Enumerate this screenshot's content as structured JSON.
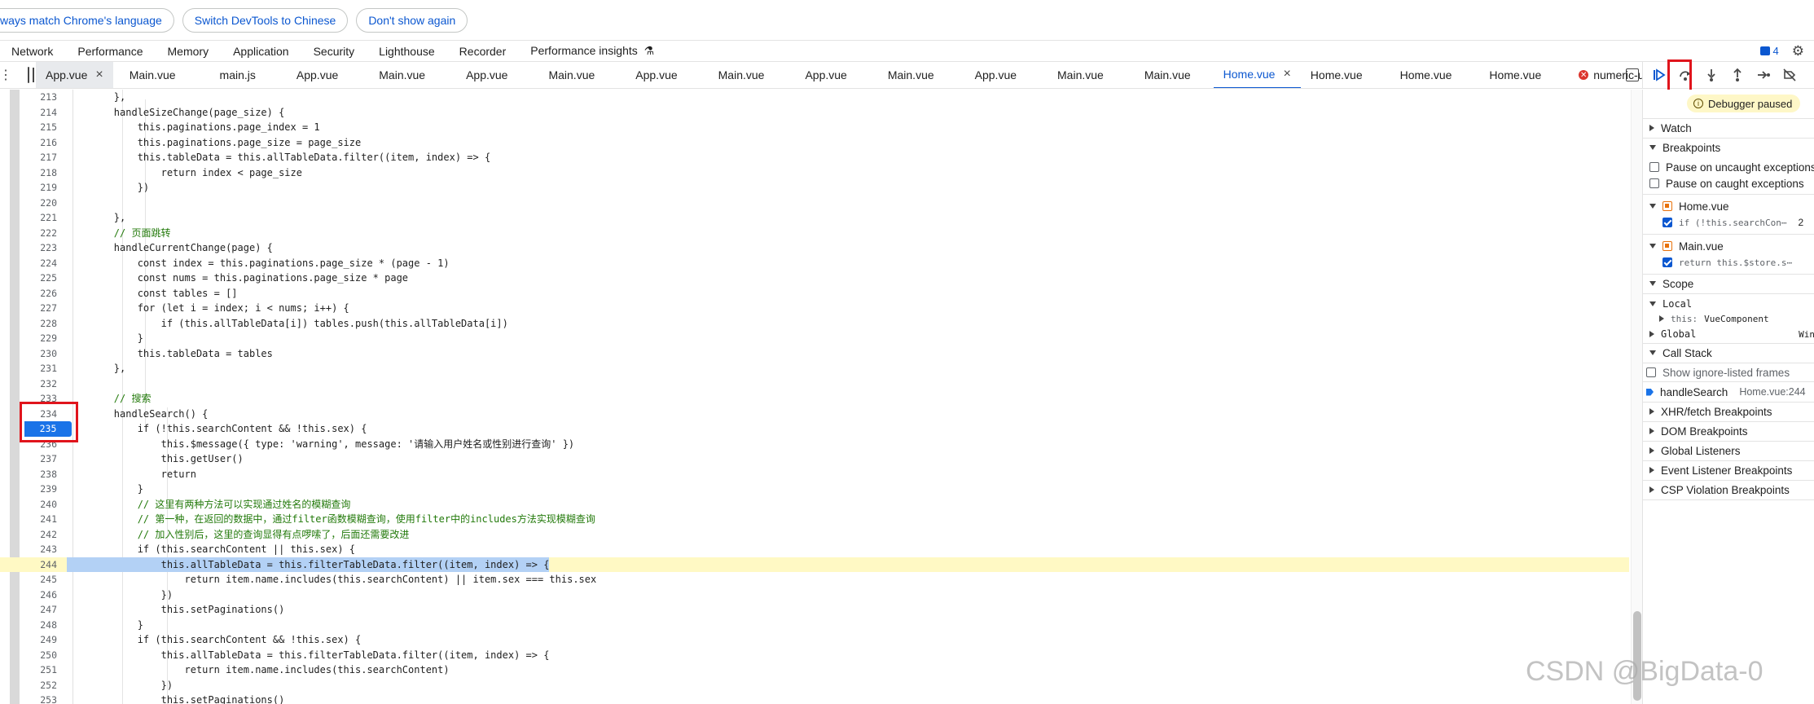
{
  "infobar": {
    "match_language": "ways match Chrome's language",
    "switch_devtools": "Switch DevTools to Chinese",
    "dont_show": "Don't show again"
  },
  "panel_tabs": [
    "Network",
    "Performance",
    "Memory",
    "Application",
    "Security",
    "Lighthouse",
    "Recorder",
    "Performance insights"
  ],
  "message_count": "4",
  "file_tabs": [
    {
      "label": "App.vue",
      "state": "selected"
    },
    {
      "label": "Main.vue"
    },
    {
      "label": "main.js"
    },
    {
      "label": "App.vue"
    },
    {
      "label": "Main.vue"
    },
    {
      "label": "App.vue"
    },
    {
      "label": "Main.vue"
    },
    {
      "label": "App.vue"
    },
    {
      "label": "Main.vue"
    },
    {
      "label": "App.vue"
    },
    {
      "label": "Main.vue"
    },
    {
      "label": "App.vue"
    },
    {
      "label": "Main.vue"
    },
    {
      "label": "Main.vue"
    },
    {
      "label": "Home.vue",
      "state": "active"
    },
    {
      "label": "Home.vue"
    },
    {
      "label": "Home.vue"
    },
    {
      "label": "Home.vue"
    },
    {
      "label": "numeric-unicode-map.ts",
      "state": "error"
    }
  ],
  "code": {
    "paused_line": "244",
    "breakpoint_line": "235",
    "lines": [
      {
        "n": "213",
        "t": "        },"
      },
      {
        "n": "214",
        "t": "        handleSizeChange(page_size) {"
      },
      {
        "n": "215",
        "t": "            this.paginations.page_index = 1"
      },
      {
        "n": "216",
        "t": "            this.paginations.page_size = page_size"
      },
      {
        "n": "217",
        "t": "            this.tableData = this.allTableData.filter((item, index) => {"
      },
      {
        "n": "218",
        "t": "                return index < page_size"
      },
      {
        "n": "219",
        "t": "            })"
      },
      {
        "n": "220",
        "t": ""
      },
      {
        "n": "221",
        "t": "        },"
      },
      {
        "n": "222",
        "t": "        // 页面跳转"
      },
      {
        "n": "223",
        "t": "        handleCurrentChange(page) {"
      },
      {
        "n": "224",
        "t": "            const index = this.paginations.page_size * (page - 1)"
      },
      {
        "n": "225",
        "t": "            const nums = this.paginations.page_size * page"
      },
      {
        "n": "226",
        "t": "            const tables = []"
      },
      {
        "n": "227",
        "t": "            for (let i = index; i < nums; i++) {"
      },
      {
        "n": "228",
        "t": "                if (this.allTableData[i]) tables.push(this.allTableData[i])"
      },
      {
        "n": "229",
        "t": "            }"
      },
      {
        "n": "230",
        "t": "            this.tableData = tables"
      },
      {
        "n": "231",
        "t": "        },"
      },
      {
        "n": "232",
        "t": ""
      },
      {
        "n": "233",
        "t": "        // 搜索"
      },
      {
        "n": "234",
        "t": "        handleSearch() {"
      },
      {
        "n": "235",
        "t": "            if (!this.searchContent && !this.sex) {"
      },
      {
        "n": "236",
        "t": "                this.$message({ type: 'warning', message: '请输入用户姓名或性别进行查询' })"
      },
      {
        "n": "237",
        "t": "                this.getUser()"
      },
      {
        "n": "238",
        "t": "                return"
      },
      {
        "n": "239",
        "t": "            }"
      },
      {
        "n": "240",
        "t": "            // 这里有两种方法可以实现通过姓名的模糊查询"
      },
      {
        "n": "241",
        "t": "            // 第一种，在返回的数据中，通过filter函数模糊查询，使用filter中的includes方法实现模糊查询"
      },
      {
        "n": "242",
        "t": "            // 加入性别后，这里的查询显得有点啰嗦了，后面还需要改进"
      },
      {
        "n": "243",
        "t": "            if (this.searchContent || this.sex) {"
      },
      {
        "n": "244",
        "t": "                this.allTableData = this.filterTableData.filter((item, index) => {"
      },
      {
        "n": "245",
        "t": "                    return item.name.includes(this.searchContent) || item.sex === this.sex"
      },
      {
        "n": "246",
        "t": "                })"
      },
      {
        "n": "247",
        "t": "                this.setPaginations()"
      },
      {
        "n": "248",
        "t": "            }"
      },
      {
        "n": "249",
        "t": "            if (this.searchContent && !this.sex) {"
      },
      {
        "n": "250",
        "t": "                this.allTableData = this.filterTableData.filter((item, index) => {"
      },
      {
        "n": "251",
        "t": "                    return item.name.includes(this.searchContent)"
      },
      {
        "n": "252",
        "t": "                })"
      },
      {
        "n": "253",
        "t": "                this.setPaginations()"
      }
    ]
  },
  "sidebar": {
    "paused_label": "Debugger paused",
    "watch": "Watch",
    "breakpoints": "Breakpoints",
    "pause_uncaught": "Pause on uncaught exceptions",
    "pause_caught": "Pause on caught exceptions",
    "bp_file1": "Home.vue",
    "bp_code1": "if (!this.searchCon⋯",
    "bp_line1": "2",
    "bp_file2": "Main.vue",
    "bp_code2": "return this.$store.s⋯",
    "scope": "Scope",
    "local": "Local",
    "this_label": "this:",
    "this_value": "VueComponent",
    "global": "Global",
    "global_value": "Win",
    "call_stack": "Call Stack",
    "show_ignore": "Show ignore-listed frames",
    "frame_name": "handleSearch",
    "frame_loc": "Home.vue:244",
    "xhr": "XHR/fetch Breakpoints",
    "dom": "DOM Breakpoints",
    "global_listeners": "Global Listeners",
    "event_listener": "Event Listener Breakpoints",
    "csp": "CSP Violation Breakpoints"
  },
  "watermark": "CSDN @BigData-0"
}
